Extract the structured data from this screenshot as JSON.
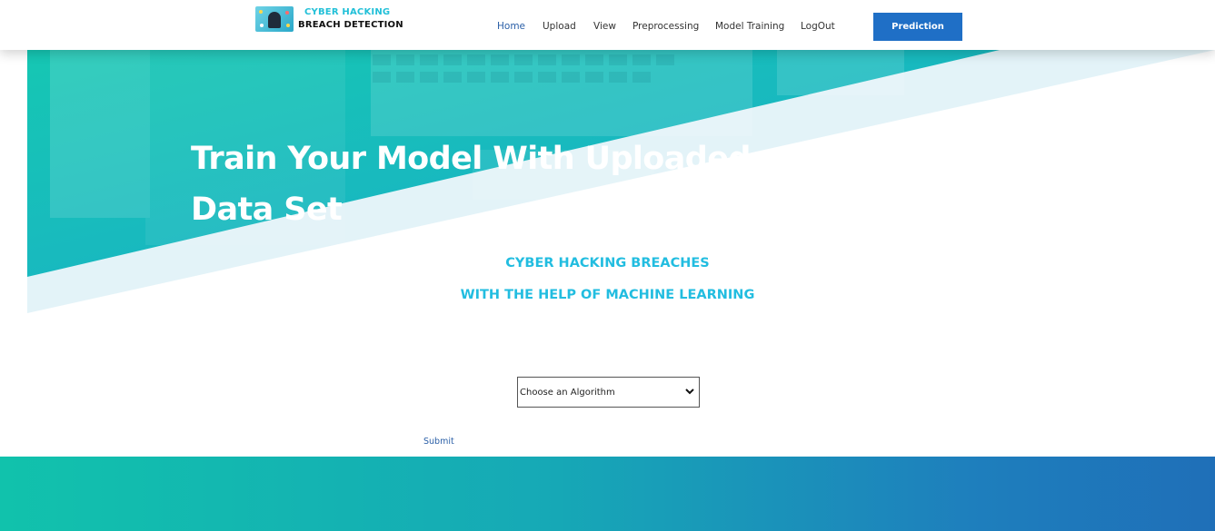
{
  "header": {
    "logo": {
      "line1": "CYBER HACKING",
      "line2": "BREACH DETECTION",
      "icon": "hacker-laptop-icon"
    },
    "nav": [
      {
        "label": "Home",
        "active": true
      },
      {
        "label": "Upload",
        "active": false
      },
      {
        "label": "View",
        "active": false
      },
      {
        "label": "Preprocessing",
        "active": false
      },
      {
        "label": "Model Training",
        "active": false
      },
      {
        "label": "LogOut",
        "active": false
      }
    ],
    "cta_label": "Prediction"
  },
  "hero": {
    "title": "Train Your Model With Uploaded Data Set"
  },
  "intro": {
    "line1": "CYBER HACKING BREACHES",
    "line2": "WITH THE HELP OF MACHINE LEARNING"
  },
  "form": {
    "select_value": "Choose an Algorithm",
    "submit_label": "Submit"
  },
  "colors": {
    "accent": "#22bde0",
    "button": "#1f6fc6",
    "nav_active": "#2a5fa7",
    "hero_teal": "#19c2b8"
  }
}
